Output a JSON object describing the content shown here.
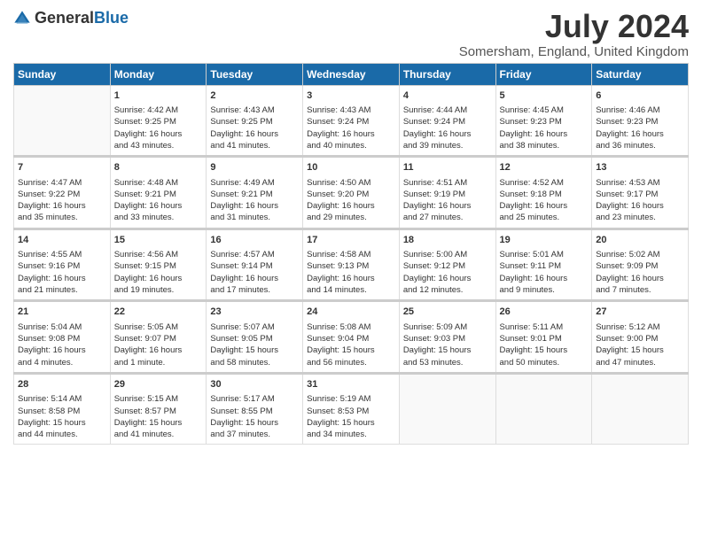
{
  "header": {
    "logo_general": "General",
    "logo_blue": "Blue",
    "month_title": "July 2024",
    "subtitle": "Somersham, England, United Kingdom"
  },
  "days_of_week": [
    "Sunday",
    "Monday",
    "Tuesday",
    "Wednesday",
    "Thursday",
    "Friday",
    "Saturday"
  ],
  "weeks": [
    [
      {
        "date": "",
        "text": ""
      },
      {
        "date": "1",
        "text": "Sunrise: 4:42 AM\nSunset: 9:25 PM\nDaylight: 16 hours\nand 43 minutes."
      },
      {
        "date": "2",
        "text": "Sunrise: 4:43 AM\nSunset: 9:25 PM\nDaylight: 16 hours\nand 41 minutes."
      },
      {
        "date": "3",
        "text": "Sunrise: 4:43 AM\nSunset: 9:24 PM\nDaylight: 16 hours\nand 40 minutes."
      },
      {
        "date": "4",
        "text": "Sunrise: 4:44 AM\nSunset: 9:24 PM\nDaylight: 16 hours\nand 39 minutes."
      },
      {
        "date": "5",
        "text": "Sunrise: 4:45 AM\nSunset: 9:23 PM\nDaylight: 16 hours\nand 38 minutes."
      },
      {
        "date": "6",
        "text": "Sunrise: 4:46 AM\nSunset: 9:23 PM\nDaylight: 16 hours\nand 36 minutes."
      }
    ],
    [
      {
        "date": "7",
        "text": "Sunrise: 4:47 AM\nSunset: 9:22 PM\nDaylight: 16 hours\nand 35 minutes."
      },
      {
        "date": "8",
        "text": "Sunrise: 4:48 AM\nSunset: 9:21 PM\nDaylight: 16 hours\nand 33 minutes."
      },
      {
        "date": "9",
        "text": "Sunrise: 4:49 AM\nSunset: 9:21 PM\nDaylight: 16 hours\nand 31 minutes."
      },
      {
        "date": "10",
        "text": "Sunrise: 4:50 AM\nSunset: 9:20 PM\nDaylight: 16 hours\nand 29 minutes."
      },
      {
        "date": "11",
        "text": "Sunrise: 4:51 AM\nSunset: 9:19 PM\nDaylight: 16 hours\nand 27 minutes."
      },
      {
        "date": "12",
        "text": "Sunrise: 4:52 AM\nSunset: 9:18 PM\nDaylight: 16 hours\nand 25 minutes."
      },
      {
        "date": "13",
        "text": "Sunrise: 4:53 AM\nSunset: 9:17 PM\nDaylight: 16 hours\nand 23 minutes."
      }
    ],
    [
      {
        "date": "14",
        "text": "Sunrise: 4:55 AM\nSunset: 9:16 PM\nDaylight: 16 hours\nand 21 minutes."
      },
      {
        "date": "15",
        "text": "Sunrise: 4:56 AM\nSunset: 9:15 PM\nDaylight: 16 hours\nand 19 minutes."
      },
      {
        "date": "16",
        "text": "Sunrise: 4:57 AM\nSunset: 9:14 PM\nDaylight: 16 hours\nand 17 minutes."
      },
      {
        "date": "17",
        "text": "Sunrise: 4:58 AM\nSunset: 9:13 PM\nDaylight: 16 hours\nand 14 minutes."
      },
      {
        "date": "18",
        "text": "Sunrise: 5:00 AM\nSunset: 9:12 PM\nDaylight: 16 hours\nand 12 minutes."
      },
      {
        "date": "19",
        "text": "Sunrise: 5:01 AM\nSunset: 9:11 PM\nDaylight: 16 hours\nand 9 minutes."
      },
      {
        "date": "20",
        "text": "Sunrise: 5:02 AM\nSunset: 9:09 PM\nDaylight: 16 hours\nand 7 minutes."
      }
    ],
    [
      {
        "date": "21",
        "text": "Sunrise: 5:04 AM\nSunset: 9:08 PM\nDaylight: 16 hours\nand 4 minutes."
      },
      {
        "date": "22",
        "text": "Sunrise: 5:05 AM\nSunset: 9:07 PM\nDaylight: 16 hours\nand 1 minute."
      },
      {
        "date": "23",
        "text": "Sunrise: 5:07 AM\nSunset: 9:05 PM\nDaylight: 15 hours\nand 58 minutes."
      },
      {
        "date": "24",
        "text": "Sunrise: 5:08 AM\nSunset: 9:04 PM\nDaylight: 15 hours\nand 56 minutes."
      },
      {
        "date": "25",
        "text": "Sunrise: 5:09 AM\nSunset: 9:03 PM\nDaylight: 15 hours\nand 53 minutes."
      },
      {
        "date": "26",
        "text": "Sunrise: 5:11 AM\nSunset: 9:01 PM\nDaylight: 15 hours\nand 50 minutes."
      },
      {
        "date": "27",
        "text": "Sunrise: 5:12 AM\nSunset: 9:00 PM\nDaylight: 15 hours\nand 47 minutes."
      }
    ],
    [
      {
        "date": "28",
        "text": "Sunrise: 5:14 AM\nSunset: 8:58 PM\nDaylight: 15 hours\nand 44 minutes."
      },
      {
        "date": "29",
        "text": "Sunrise: 5:15 AM\nSunset: 8:57 PM\nDaylight: 15 hours\nand 41 minutes."
      },
      {
        "date": "30",
        "text": "Sunrise: 5:17 AM\nSunset: 8:55 PM\nDaylight: 15 hours\nand 37 minutes."
      },
      {
        "date": "31",
        "text": "Sunrise: 5:19 AM\nSunset: 8:53 PM\nDaylight: 15 hours\nand 34 minutes."
      },
      {
        "date": "",
        "text": ""
      },
      {
        "date": "",
        "text": ""
      },
      {
        "date": "",
        "text": ""
      }
    ]
  ]
}
